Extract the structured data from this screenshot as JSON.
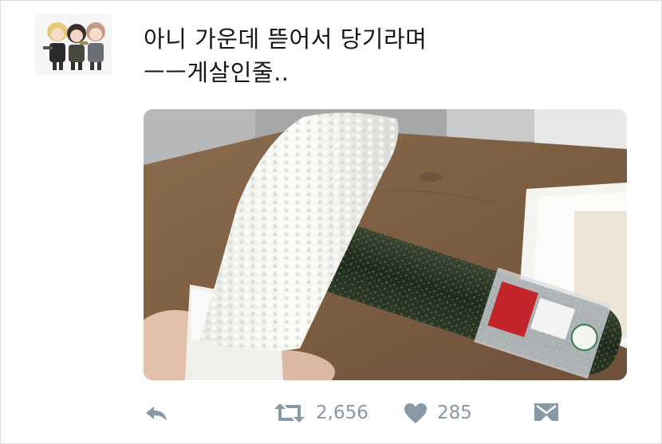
{
  "tweet": {
    "text_lines": [
      "아니 가운데 뜯어서 당기라며",
      "ㅡㅡ게살인줄.."
    ],
    "retweet_count": "2,656",
    "like_count": "285"
  },
  "avatar": {
    "alt": "anime-characters-avatar"
  },
  "media": {
    "subject": "kimbap-rice-only-photo"
  },
  "icons": {
    "reply": "reply-icon",
    "retweet": "retweet-icon",
    "like": "heart-icon",
    "message": "direct-message-icon"
  },
  "colors": {
    "action_gray": "#8899a6",
    "text": "#14171a",
    "border": "#d9dde0"
  }
}
